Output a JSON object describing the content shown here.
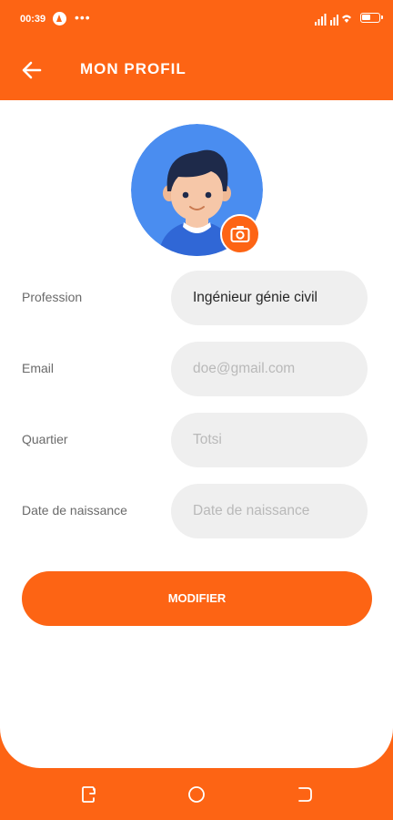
{
  "status_bar": {
    "time": "00:39",
    "dots": "•••",
    "icons": [
      "app-notification-icon",
      "cellular-signal-icon",
      "wifi-signal-icon",
      "battery-icon"
    ]
  },
  "app_bar": {
    "title": "MON PROFIL",
    "back_icon": "arrow-left-icon"
  },
  "profile": {
    "avatar": "user-avatar",
    "camera_icon": "camera-icon"
  },
  "form": {
    "fields": [
      {
        "label": "Profession",
        "value": "Ingénieur génie civil",
        "placeholder": ""
      },
      {
        "label": "Email",
        "value": "",
        "placeholder": "doe@gmail.com"
      },
      {
        "label": "Quartier",
        "value": "",
        "placeholder": "Totsi"
      },
      {
        "label": "Date de naissance",
        "value": "",
        "placeholder": "Date de naissance"
      }
    ],
    "submit_label": "MODIFIER"
  },
  "nav_bar": {
    "icons": [
      "recent-apps-icon",
      "home-icon",
      "back-icon"
    ]
  },
  "colors": {
    "accent": "#fd6414",
    "avatar_bg": "#4a8df0",
    "field_bg": "#efefef",
    "placeholder": "#b9b9b9",
    "label": "#6a6a6a"
  }
}
